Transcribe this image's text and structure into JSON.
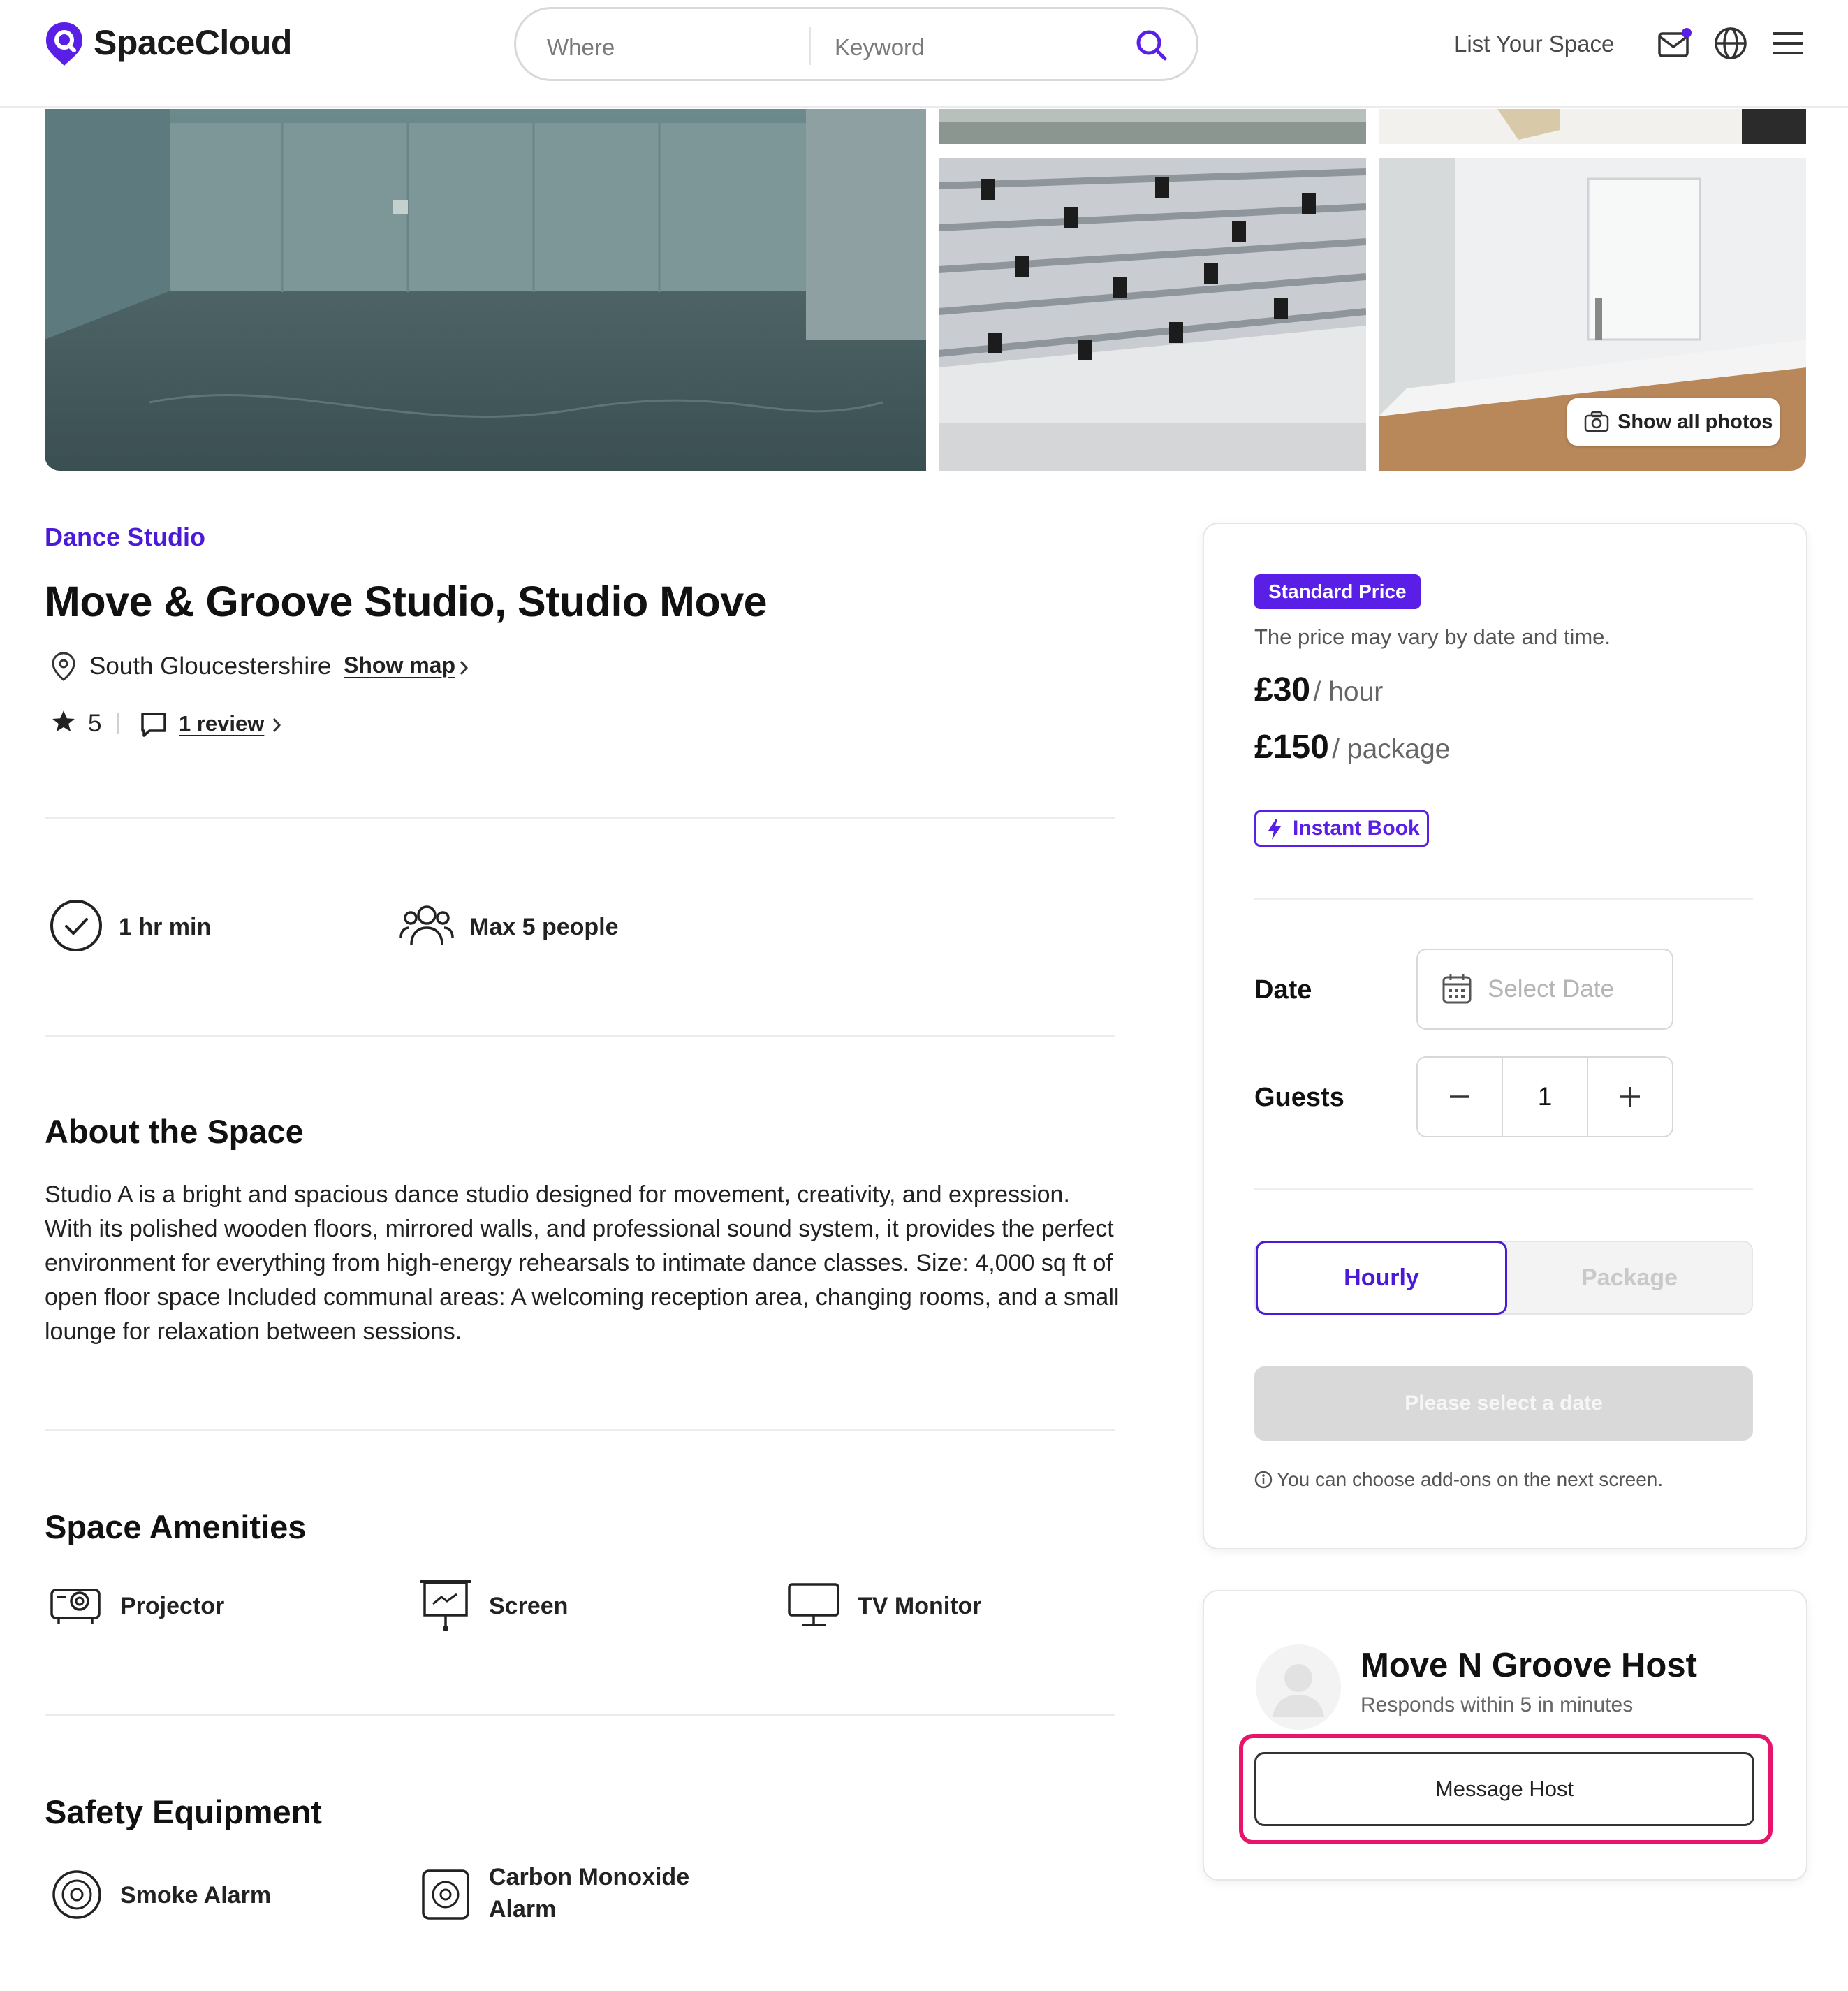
{
  "header": {
    "brand": "SpaceCloud",
    "search": {
      "where_placeholder": "Where",
      "keyword_placeholder": "Keyword"
    },
    "list_space": "List Your Space",
    "icons": [
      "mail-icon",
      "globe-icon",
      "menu-icon",
      "search-icon"
    ]
  },
  "gallery": {
    "show_all_label": "Show all photos"
  },
  "listing": {
    "category": "Dance Studio",
    "title": "Move & Groove Studio, Studio Move",
    "location": "South Gloucestershire",
    "show_map": "Show map",
    "rating": "5",
    "reviews_link": "1 review"
  },
  "features": [
    {
      "icon": "check-circle-icon",
      "label": "1 hr min"
    },
    {
      "icon": "people-icon",
      "label": "Max 5 people"
    }
  ],
  "about": {
    "heading": "About the Space",
    "body": "Studio A is a bright and spacious dance studio designed for movement, creativity, and expression. With its polished wooden floors, mirrored walls, and professional sound system, it provides the perfect environment for everything from high-energy rehearsals to intimate dance classes. Size: 4,000 sq ft of open floor space Included communal areas: A welcoming reception area, changing rooms, and a small lounge for relaxation between sessions."
  },
  "amenities": {
    "heading": "Space Amenities",
    "items": [
      {
        "icon": "projector-icon",
        "label": "Projector"
      },
      {
        "icon": "screen-icon",
        "label": "Screen"
      },
      {
        "icon": "tv-monitor-icon",
        "label": "TV Monitor"
      }
    ]
  },
  "safety": {
    "heading": "Safety Equipment",
    "items": [
      {
        "icon": "smoke-alarm-icon",
        "label": "Smoke Alarm"
      },
      {
        "icon": "co-alarm-icon",
        "label_line1": "Carbon Monoxide",
        "label_line2": "Alarm"
      }
    ]
  },
  "booking": {
    "badge": "Standard Price",
    "note": "The price may vary by date and time.",
    "hourly_price": "£30",
    "hourly_unit": "/ hour",
    "package_price": "£150",
    "package_unit": "/ package",
    "instant_book": "Instant Book",
    "date_label": "Date",
    "date_placeholder": "Select Date",
    "guests_label": "Guests",
    "guests_value": "1",
    "minus": "−",
    "plus": "+",
    "toggle_hourly": "Hourly",
    "toggle_package": "Package",
    "cta": "Please select a date",
    "addon_note": "You can choose add-ons on the next screen."
  },
  "host": {
    "name": "Move N Groove Host",
    "responds": "Responds within 5 in minutes",
    "message_button": "Message Host"
  },
  "colors": {
    "brand": "#5a1fe6",
    "accent_text": "#4a1ad8",
    "highlight": "#e8146c"
  }
}
